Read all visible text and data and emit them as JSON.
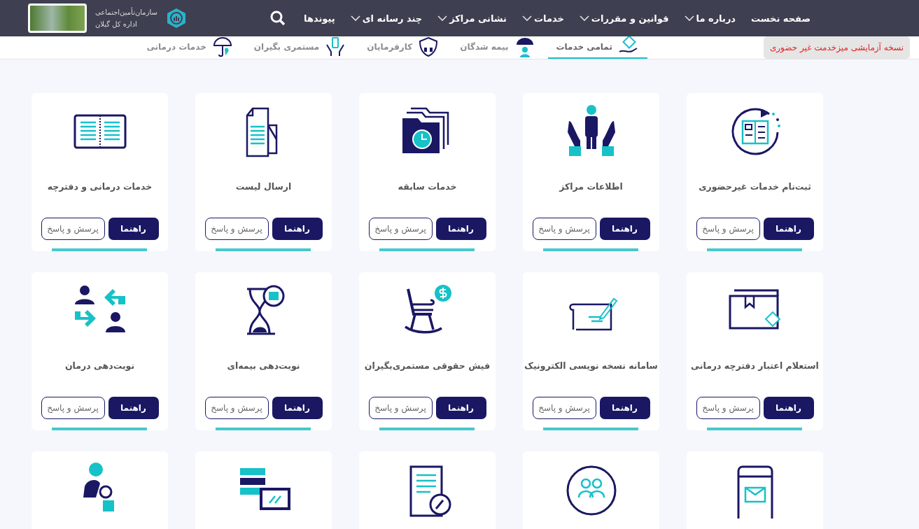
{
  "header": {
    "logo": {
      "line_1": "سازمان‌تأمین‌اجتماعی",
      "line_2": "اداره کل گیلان"
    },
    "nav": [
      {
        "label": "صفحه نخست",
        "has_menu": false
      },
      {
        "label": "درباره ما",
        "has_menu": true
      },
      {
        "label": "قوانین و مقررات",
        "has_menu": true
      },
      {
        "label": "خدمات",
        "has_menu": true
      },
      {
        "label": "نشانی مراکز",
        "has_menu": true
      },
      {
        "label": "چند رسانه ای",
        "has_menu": true
      },
      {
        "label": "پیوندها",
        "has_menu": false
      }
    ]
  },
  "subnav": {
    "trial_button": "نسخه آزمایشی میزخدمت غیر حضوری",
    "tabs": [
      {
        "label": "تمامی خدمات",
        "selected": true
      },
      {
        "label": "بیمه شدگان",
        "selected": false
      },
      {
        "label": "کارفرمایان",
        "selected": false
      },
      {
        "label": "مستمری بگیران",
        "selected": false
      },
      {
        "label": "خدمات درمانی",
        "selected": false
      }
    ]
  },
  "cards": [
    {
      "title": "ثبت‌نام خدمات غیرحضوری",
      "guide": "راهنما",
      "faq": "پرسش و پاسخ"
    },
    {
      "title": "اطلاعات مراکز",
      "guide": "راهنما",
      "faq": "پرسش و پاسخ"
    },
    {
      "title": "خدمات سابقه",
      "guide": "راهنما",
      "faq": "پرسش و پاسخ"
    },
    {
      "title": "ارسال لیست",
      "guide": "راهنما",
      "faq": "پرسش و پاسخ"
    },
    {
      "title": "خدمات درمانی و دفترچه",
      "guide": "راهنما",
      "faq": "پرسش و پاسخ"
    },
    {
      "title": "استعلام اعتبار دفترچه درمانی",
      "guide": "راهنما",
      "faq": "پرسش و پاسخ"
    },
    {
      "title": "سامانه نسخه نویسی الکترونیک",
      "guide": "راهنما",
      "faq": "پرسش و پاسخ"
    },
    {
      "title": "فیش حقوقی مستمری‌بگیران",
      "guide": "راهنما",
      "faq": "پرسش و پاسخ"
    },
    {
      "title": "نوبت‌دهی بیمه‌ای",
      "guide": "راهنما",
      "faq": "پرسش و پاسخ"
    },
    {
      "title": "نوبت‌دهی درمان",
      "guide": "راهنما",
      "faq": "پرسش و پاسخ"
    },
    {
      "kind": "cut"
    },
    {
      "kind": "cut"
    },
    {
      "kind": "cut"
    },
    {
      "kind": "cut"
    },
    {
      "kind": "cut"
    }
  ]
}
